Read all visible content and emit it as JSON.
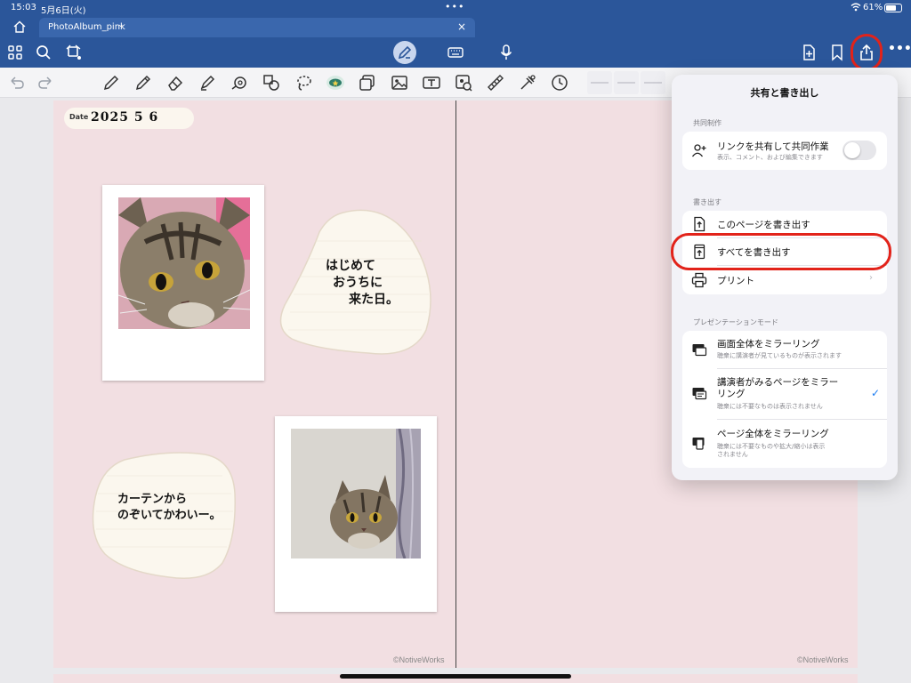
{
  "status": {
    "time": "15:03",
    "date": "5月6日(火)",
    "dots": "•••",
    "battery": "61%"
  },
  "tabs": {
    "active_label": "PhotoAlbum_pink",
    "chevron": "⌄",
    "close": "×"
  },
  "toolbar": {
    "icons_left": [
      "grid-icon",
      "search-icon",
      "lasso-select-icon"
    ],
    "icons_center": [
      "pen-mode-icon",
      "keyboard-icon",
      "microphone-icon"
    ],
    "icons_right": [
      "add-page-icon",
      "bookmark-icon",
      "share-icon",
      "more-icon"
    ],
    "more": "•••"
  },
  "tools": [
    "pen",
    "pencil",
    "eraser",
    "highlighter",
    "shape",
    "shapes-lock",
    "lasso",
    "sticker",
    "element",
    "image",
    "text-box",
    "camera-capture",
    "ruler",
    "laser-pointer",
    "clock"
  ],
  "page": {
    "date_label": "Date",
    "date_value": "2025  5  6",
    "bubble1_lines": [
      "はじめて",
      "おうちに",
      "来た日。"
    ],
    "bubble2_lines": [
      "カーテンから",
      "のぞいてかわいー。"
    ],
    "credit_left": "©NotiveWorks",
    "credit_right": "©NotiveWorks"
  },
  "popover": {
    "title": "共有と書き出し",
    "section_collab": "共同制作",
    "share_link_label": "リンクを共有して共同作業",
    "share_link_sub": "表示、コメント、および編集できます",
    "section_export": "書き出す",
    "export_page": "このページを書き出す",
    "export_all": "すべてを書き出す",
    "print": "プリント",
    "section_present": "プレゼンテーションモード",
    "mirror_screen": "画面全体をミラーリング",
    "mirror_screen_sub": "聴衆に講演者が見ているものが表示されます",
    "mirror_presenter_line1": "講演者がみるページをミラー",
    "mirror_presenter_line2": "リング",
    "mirror_presenter_sub": "聴衆には不要なものは表示されません",
    "mirror_page": "ページ全体をミラーリング",
    "mirror_page_sub1": "聴衆には不要なものや拡大/縮小は表示",
    "mirror_page_sub2": "されません",
    "chevron": "›",
    "check": "✓"
  },
  "colors": {
    "header": "#2b569a",
    "page": "#f2dfe2",
    "highlight": "#e2231a",
    "accent": "#1a7cf2"
  }
}
